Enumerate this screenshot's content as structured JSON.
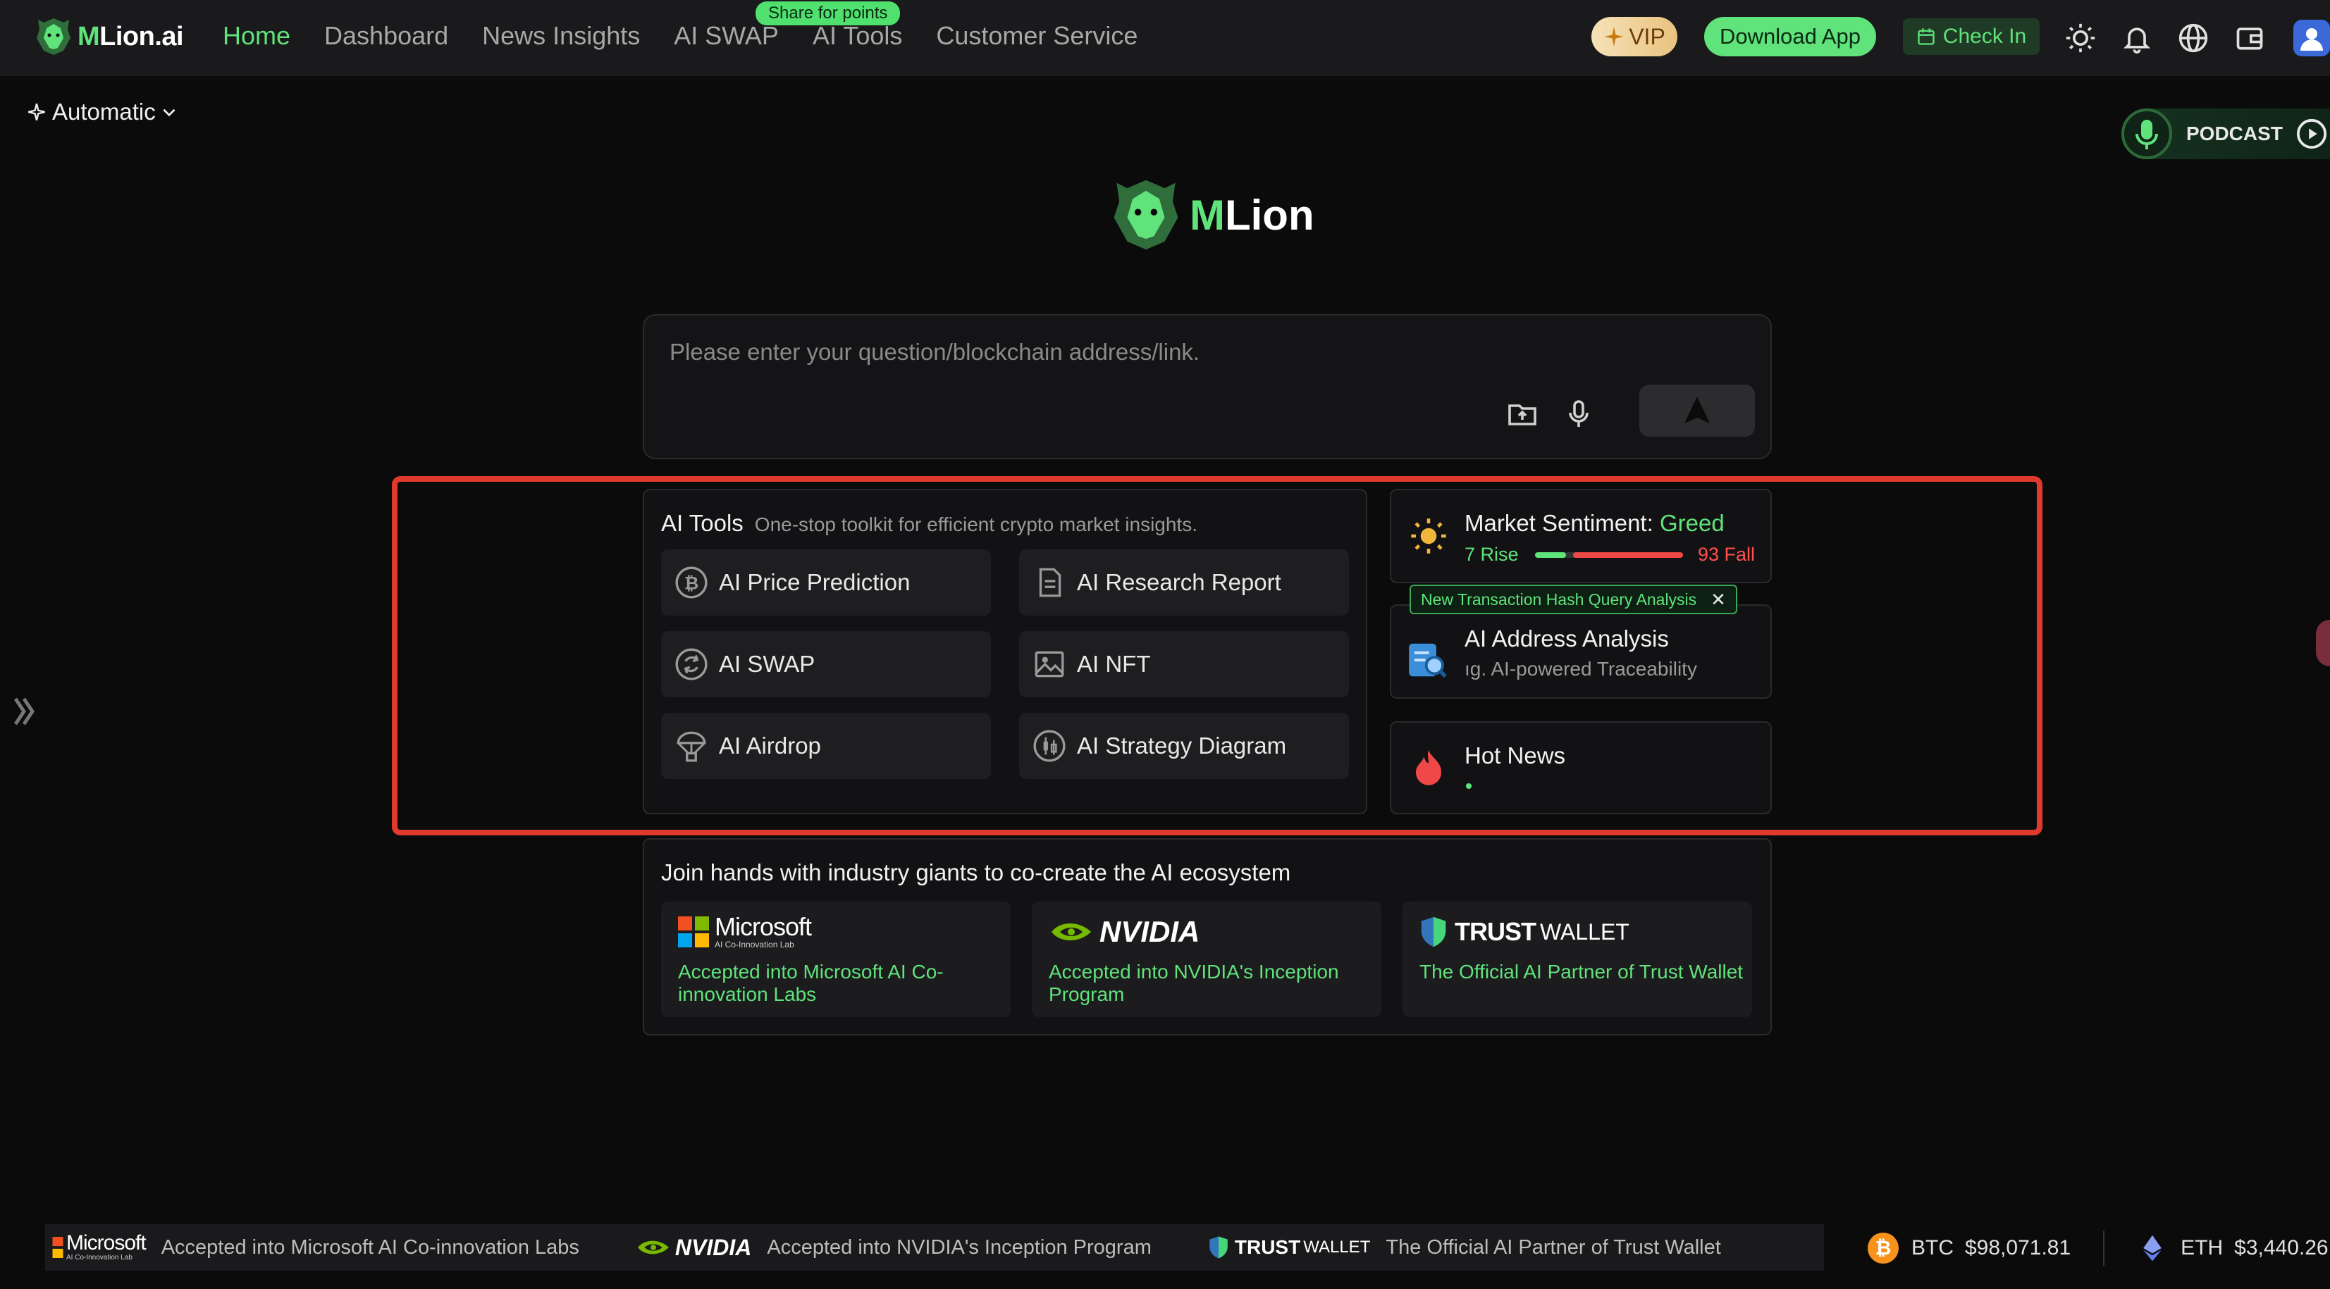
{
  "nav": {
    "logo_m": "M",
    "logo_rest": "Lion.ai",
    "links": [
      "Home",
      "Dashboard",
      "News Insights",
      "AI SWAP",
      "AI Tools",
      "Customer Service"
    ],
    "share_badge": "Share for points",
    "vip_label": "VIP",
    "download_label": "Download App",
    "checkin_label": "Check In"
  },
  "mode": {
    "label": "Automatic"
  },
  "podcast": {
    "label": "PODCAST"
  },
  "brand": {
    "m": "M",
    "rest": "Lion"
  },
  "ask": {
    "placeholder": "Please enter your question/blockchain address/link."
  },
  "tools": {
    "title": "AI Tools",
    "subtitle": "One-stop toolkit for efficient crypto market insights.",
    "items": [
      {
        "label": "AI Price Prediction",
        "icon": "bitcoin-icon"
      },
      {
        "label": "AI Research Report",
        "icon": "document-icon"
      },
      {
        "label": "AI SWAP",
        "icon": "swap-icon"
      },
      {
        "label": "AI NFT",
        "icon": "image-icon"
      },
      {
        "label": "AI Airdrop",
        "icon": "parachute-icon"
      },
      {
        "label": "AI Strategy Diagram",
        "icon": "candlestick-icon"
      }
    ]
  },
  "sentiment": {
    "title_prefix": "Market Sentiment: ",
    "value": "Greed",
    "rise_label": "7 Rise",
    "fall_label": "93 Fall",
    "rise_count": 7,
    "fall_count": 93
  },
  "tooltip": {
    "text": "New Transaction Hash Query Analysis",
    "close": "✕"
  },
  "address": {
    "title": "AI Address Analysis",
    "subtitle": "ıg. AI-powered Traceability"
  },
  "news": {
    "title": "Hot News"
  },
  "partners": {
    "title": "Join hands with industry giants to co-create the AI ecosystem",
    "items": [
      {
        "brand": "Microsoft",
        "brand_sub": "AI Co-Innovation Lab",
        "desc": "Accepted into Microsoft AI Co-innovation Labs"
      },
      {
        "brand": "NVIDIA",
        "desc": "Accepted into NVIDIA's Inception Program"
      },
      {
        "brand": "TRUST",
        "brand_2": "WALLET",
        "desc": "The Official AI Partner of Trust Wallet"
      }
    ]
  },
  "ticker": {
    "items": [
      {
        "brand": "Microsoft",
        "brand_sub": "AI Co-Innovation Lab",
        "text": "Accepted into Microsoft AI Co-innovation Labs"
      },
      {
        "brand": "NVIDIA",
        "text": "Accepted into NVIDIA's Inception Program"
      },
      {
        "brand": "TRUST",
        "brand_2": "WALLET",
        "text": "The Official AI Partner of Trust Wallet"
      }
    ]
  },
  "prices": [
    {
      "symbol": "BTC",
      "value": "$98,071.81",
      "color": "#f7931a"
    },
    {
      "symbol": "ETH",
      "value": "$3,440.26",
      "color": "#627eea"
    }
  ],
  "colors": {
    "accent": "#5fe37a",
    "highlight": "#e03a2d",
    "fall": "#ff4f4f"
  }
}
